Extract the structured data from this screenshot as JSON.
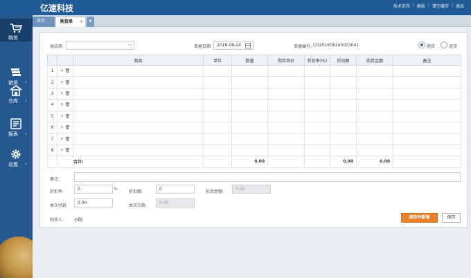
{
  "header": {
    "logo": "亿速科技",
    "links": [
      "技术支持",
      "换肤",
      "清空缓存",
      "退出"
    ],
    "separators": [
      "|",
      "|",
      "|"
    ]
  },
  "sidebar": {
    "items": [
      {
        "label": "购货",
        "icon": "cart-icon",
        "arrow": ""
      },
      {
        "label": "销货",
        "icon": "sales-icon",
        "arrow": "›"
      },
      {
        "label": "仓库",
        "icon": "warehouse-icon",
        "arrow": "›"
      },
      {
        "label": "报表",
        "icon": "report-icon",
        "arrow": "›"
      },
      {
        "label": "设置",
        "icon": "gear-icon",
        "arrow": "›"
      }
    ]
  },
  "tabs": {
    "home": "首页",
    "active": "购货单",
    "close": "×",
    "more": "▼"
  },
  "form": {
    "supplier_label": "供应商:",
    "supplier_value": "",
    "supplier_picker": "···",
    "date_label": "单据日期:",
    "date_value": "2016-08-24",
    "docno_label": "单据编号:",
    "docno_value": "CG201608240003041",
    "radio_purchase": "购货",
    "radio_return": "退货",
    "radio_selected": "purchase"
  },
  "grid": {
    "columns": [
      "",
      "",
      "商品",
      "单位",
      "数量",
      "购货单价",
      "折扣率(%)",
      "折扣额",
      "购货金额",
      "备注"
    ],
    "row_numbers": [
      "1",
      "2",
      "3",
      "4",
      "5",
      "6",
      "7",
      "8"
    ],
    "row_ops": "+ 🗑",
    "total_label": "合计:",
    "total_qty": "0.00",
    "total_discount": "0.00",
    "total_amount": "0.00"
  },
  "bottom": {
    "remark_label": "备注:",
    "remark_value": "",
    "discount_rate_label": "折扣率:",
    "discount_rate_value": "0",
    "discount_rate_unit": "%",
    "discount_amount_label": "折扣额:",
    "discount_amount_value": "0",
    "after_discount_label": "折后金额:",
    "after_discount_value": "0.00",
    "paid_label": "本次付款:",
    "paid_value": "0.00",
    "owed_label": "本次欠款:",
    "owed_value": "0.00",
    "maker_label": "制单人:",
    "maker_value": "小阳",
    "save_new_label": "保存并新增",
    "save_label": "保存"
  },
  "colors": {
    "header": "#1f5a96",
    "sidebar": "#24588f",
    "sidebar_active": "#183f69",
    "primary_button": "#e8812a"
  }
}
